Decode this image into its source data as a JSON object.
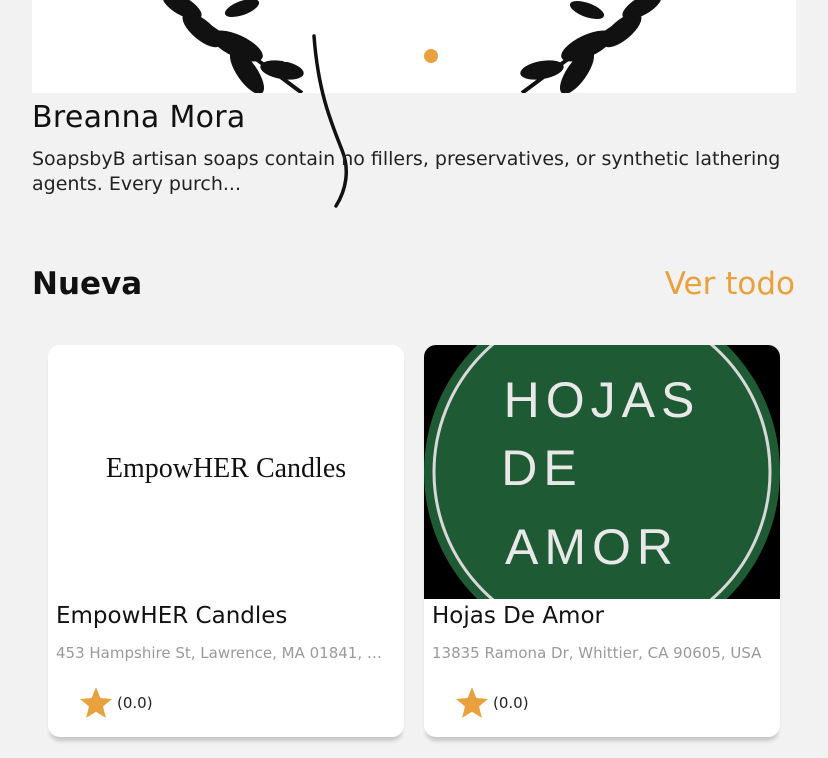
{
  "seller": {
    "name": "Breanna Mora",
    "description": "SoapsbyB artisan soaps contain no fillers, preservatives, or synthetic lathering agents. Every purch..."
  },
  "carousel": {
    "slide_count": 3,
    "active_index": 1
  },
  "section": {
    "title": "Nueva",
    "see_all": "Ver todo"
  },
  "cards": [
    {
      "title": "EmpowHER Candles",
      "logo_text": "EmpowHER Candles",
      "address": "453 Hampshire St, Lawrence, MA 01841, U...",
      "rating": "(0.0)"
    },
    {
      "title": "Hojas De Amor",
      "logo_lines": [
        "HOJAS",
        "DE",
        "AMOR"
      ],
      "address": "13835 Ramona Dr, Whittier, CA 90605, USA",
      "rating": "(0.0)"
    }
  ],
  "colors": {
    "accent": "#e8a13c",
    "background": "#f2f2f2",
    "logo_green": "#1e5a34"
  }
}
